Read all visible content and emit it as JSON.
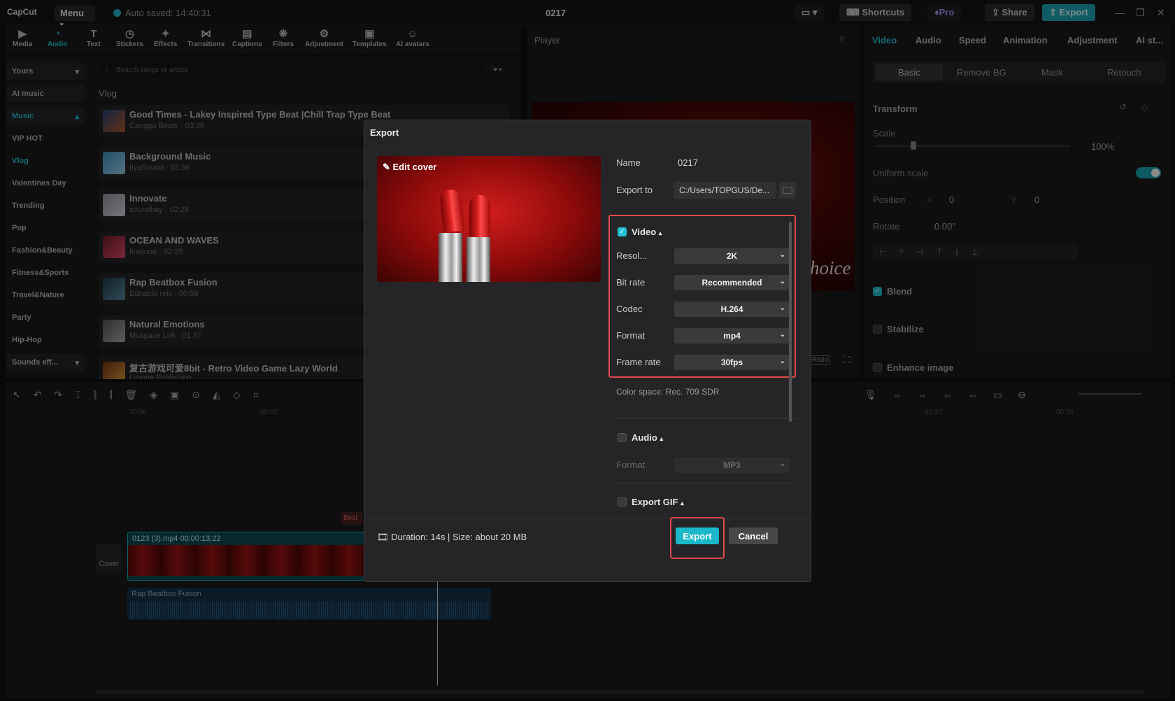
{
  "titlebar": {
    "logo": "CapCut",
    "menu": "Menu",
    "autosave": "Auto saved: 14:40:31",
    "project": "0217",
    "shortcuts": "Shortcuts",
    "pro": "Pro",
    "share": "Share",
    "export": "Export"
  },
  "mediabar": {
    "tools": [
      {
        "label": "Media",
        "icon": "media-icon"
      },
      {
        "label": "Audio",
        "icon": "audio-icon"
      },
      {
        "label": "Text",
        "icon": "text-icon"
      },
      {
        "label": "Stickers",
        "icon": "stickers-icon"
      },
      {
        "label": "Effects",
        "icon": "effects-icon"
      },
      {
        "label": "Transitions",
        "icon": "transitions-icon"
      },
      {
        "label": "Captions",
        "icon": "captions-icon"
      },
      {
        "label": "Filters",
        "icon": "filters-icon"
      },
      {
        "label": "Adjustment",
        "icon": "adjustment-icon"
      },
      {
        "label": "Templates",
        "icon": "templates-icon"
      },
      {
        "label": "AI avatars",
        "icon": "ai-avatars-icon"
      }
    ]
  },
  "sidebar": {
    "items": [
      "Yours",
      "AI music",
      "Music",
      "VIP HOT",
      "Vlog",
      "Valentines Day",
      "Trending",
      "Pop",
      "Fashion&Beauty",
      "Fitness&Sports",
      "Travel&Nature",
      "Party",
      "Hip-Hop",
      "Sounds eff..."
    ]
  },
  "search": {
    "placeholder": "Search songs or artists"
  },
  "library": {
    "section": "Vlog",
    "tracks": [
      {
        "title": "Good Times - Lakey Inspired Type Beat |Chill Trap Type Beat",
        "meta": "Canggu Beats · 03:36"
      },
      {
        "title": "Background Music",
        "meta": "IlyaSound · 03:36"
      },
      {
        "title": "Innovate",
        "meta": "soundbay · 02:28"
      },
      {
        "title": "OCEAN AND WAVES",
        "meta": "finetune · 02:35"
      },
      {
        "title": "Rap Beatbox Fusion",
        "meta": "Ednaldo reis · 00:59"
      },
      {
        "title": "Natural Emotions",
        "meta": "Muspace Lofi · 01:37"
      },
      {
        "title": "复古游戏可爱8bit - Retro Video Game Lazy World",
        "meta": "Lysone Publishing"
      }
    ]
  },
  "player": {
    "label": "Player",
    "overlay_text": "hoice",
    "ratio": "Ratio"
  },
  "rightpanel": {
    "tabs": [
      "Video",
      "Audio",
      "Speed",
      "Animation",
      "Adjustment",
      "AI st..."
    ],
    "subtabs": [
      "Basic",
      "Remove BG",
      "Mask",
      "Retouch"
    ],
    "transform": "Transform",
    "scale": "Scale",
    "scale_value": "100%",
    "uniform_scale": "Uniform scale",
    "position": "Position",
    "pos_x_label": "X",
    "pos_x": "0",
    "pos_y_label": "Y",
    "pos_y": "0",
    "rotate": "Rotate",
    "rotate_value": "0.00°",
    "blend": "Blend",
    "stabilize": "Stabilize",
    "enhance": "Enhance image"
  },
  "timeline": {
    "ticks": [
      "00:00",
      "00:05",
      "00:30",
      "00:35"
    ],
    "clip_label": "0123 (3).mp4  00:00:13:22",
    "audio_label": "Rap Beatbox Fusion",
    "cover": "Cover",
    "best": "Best"
  },
  "modal": {
    "title": "Export",
    "edit_cover": "Edit cover",
    "name_label": "Name",
    "name_value": "0217",
    "export_to_label": "Export to",
    "export_to_value": "C:/Users/TOPGUS/De...",
    "video_section": "Video",
    "resolution_label": "Resol...",
    "resolution": "2K",
    "bitrate_label": "Bit rate",
    "bitrate": "Recommended",
    "codec_label": "Codec",
    "codec": "H.264",
    "format_label": "Format",
    "format": "mp4",
    "framerate_label": "Frame rate",
    "framerate": "30fps",
    "color_space": "Color space: Rec. 709 SDR",
    "audio_section": "Audio",
    "audio_format_label": "Format",
    "audio_format": "MP3",
    "gif_section": "Export GIF",
    "duration": "Duration: 14s | Size: about 20 MB",
    "export_btn": "Export",
    "cancel_btn": "Cancel"
  },
  "colors": {
    "accent": "#21c4d6",
    "highlight": "#e04a4a"
  }
}
